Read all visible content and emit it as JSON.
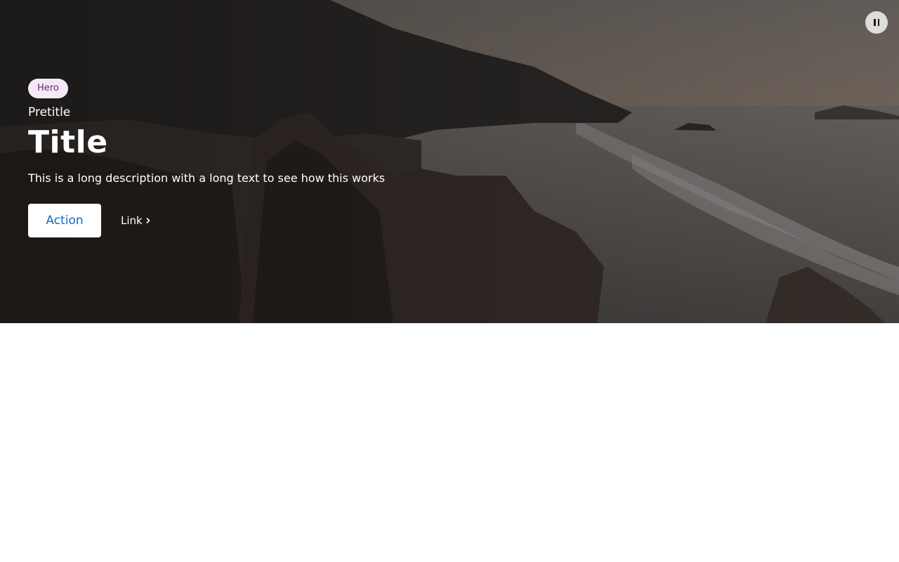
{
  "hero": {
    "tag": "Hero",
    "pretitle": "Pretitle",
    "title": "Title",
    "description": "This is a long description with a long text to see how this works",
    "action_label": "Action",
    "link_label": "Link",
    "background_image": "coastal-rocks-ocean-sunset"
  },
  "controls": {
    "pause_icon": "pause-icon"
  },
  "colors": {
    "tag_bg": "#f5e9f6",
    "tag_text": "#6b2a6f",
    "action_text": "#0b6ec9",
    "page_bg": "#ffffff"
  }
}
